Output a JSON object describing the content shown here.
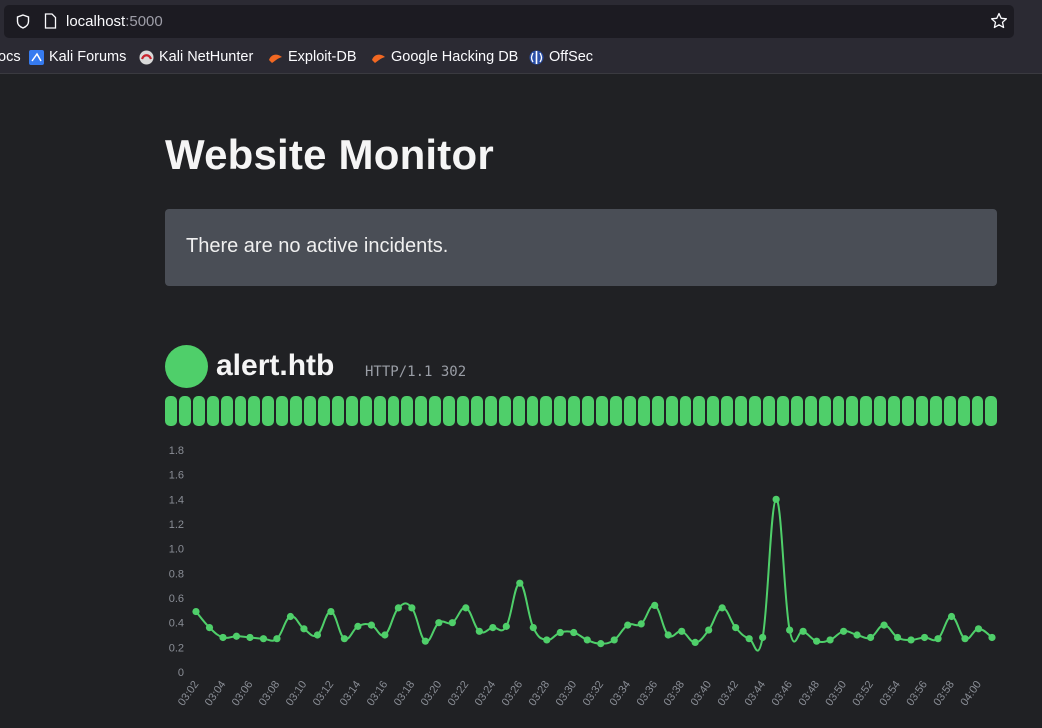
{
  "browser": {
    "url_host": "localhost",
    "url_port": ":5000",
    "bookmarks": [
      {
        "label": "ocs",
        "icon": "docs-icon"
      },
      {
        "label": "Kali Forums",
        "icon": "kali-forums-icon"
      },
      {
        "label": "Kali NetHunter",
        "icon": "kali-nethunter-icon"
      },
      {
        "label": "Exploit-DB",
        "icon": "exploit-db-icon"
      },
      {
        "label": "Google Hacking DB",
        "icon": "google-hacking-db-icon"
      },
      {
        "label": "OffSec",
        "icon": "offsec-icon"
      }
    ]
  },
  "page": {
    "title": "Website Monitor",
    "incident_text": "There are no active incidents."
  },
  "monitor": {
    "site": "alert.htb",
    "status": "HTTP/1.1 302",
    "status_color": "#4fcf6a",
    "uptime_checks": [
      "up",
      "up",
      "up",
      "up",
      "up",
      "up",
      "up",
      "up",
      "up",
      "up",
      "up",
      "up",
      "up",
      "up",
      "up",
      "up",
      "up",
      "up",
      "up",
      "up",
      "up",
      "up",
      "up",
      "up",
      "up",
      "up",
      "up",
      "up",
      "up",
      "up",
      "up",
      "up",
      "up",
      "up",
      "up",
      "up",
      "up",
      "up",
      "up",
      "up",
      "up",
      "up",
      "up",
      "up",
      "up",
      "up",
      "up",
      "up",
      "up",
      "up",
      "up",
      "up",
      "up",
      "up",
      "up",
      "up",
      "up",
      "up",
      "up",
      "up"
    ]
  },
  "chart_data": {
    "type": "line",
    "color": "#4fcf6a",
    "grid": false,
    "ylim": [
      0,
      1.8
    ],
    "yticks": [
      "0",
      "0.2",
      "0.4",
      "0.6",
      "0.8",
      "1.0",
      "1.2",
      "1.4",
      "1.6",
      "1.8"
    ],
    "xtick_labels": [
      "03:02",
      "03:04",
      "03:06",
      "03:08",
      "03:10",
      "03:12",
      "03:14",
      "03:16",
      "03:18",
      "03:20",
      "03:22",
      "03:24",
      "03:26",
      "03:28",
      "03:30",
      "03:32",
      "03:34",
      "03:36",
      "03:38",
      "03:40",
      "03:42",
      "03:44",
      "03:46",
      "03:48",
      "03:50",
      "03:52",
      "03:54",
      "03:56",
      "03:58",
      "04:00"
    ],
    "x": [
      "03:02",
      "03:03",
      "03:04",
      "03:05",
      "03:06",
      "03:07",
      "03:08",
      "03:09",
      "03:10",
      "03:11",
      "03:12",
      "03:13",
      "03:14",
      "03:15",
      "03:16",
      "03:17",
      "03:18",
      "03:19",
      "03:20",
      "03:21",
      "03:22",
      "03:23",
      "03:24",
      "03:25",
      "03:26",
      "03:27",
      "03:28",
      "03:29",
      "03:30",
      "03:31",
      "03:32",
      "03:33",
      "03:34",
      "03:35",
      "03:36",
      "03:37",
      "03:38",
      "03:39",
      "03:40",
      "03:41",
      "03:42",
      "03:43",
      "03:44",
      "03:45",
      "03:46",
      "03:47",
      "03:48",
      "03:49",
      "03:50",
      "03:51",
      "03:52",
      "03:53",
      "03:54",
      "03:55",
      "03:56",
      "03:57",
      "03:58",
      "03:59",
      "04:00",
      "04:01"
    ],
    "y": [
      0.49,
      0.36,
      0.28,
      0.29,
      0.28,
      0.27,
      0.27,
      0.45,
      0.35,
      0.3,
      0.49,
      0.27,
      0.37,
      0.38,
      0.3,
      0.52,
      0.52,
      0.25,
      0.4,
      0.4,
      0.52,
      0.33,
      0.36,
      0.37,
      0.72,
      0.36,
      0.26,
      0.32,
      0.32,
      0.26,
      0.23,
      0.26,
      0.38,
      0.39,
      0.54,
      0.3,
      0.33,
      0.24,
      0.34,
      0.52,
      0.36,
      0.27,
      0.28,
      1.4,
      0.34,
      0.33,
      0.25,
      0.26,
      0.33,
      0.3,
      0.28,
      0.38,
      0.28,
      0.26,
      0.28,
      0.27,
      0.45,
      0.27,
      0.35,
      0.28
    ]
  }
}
